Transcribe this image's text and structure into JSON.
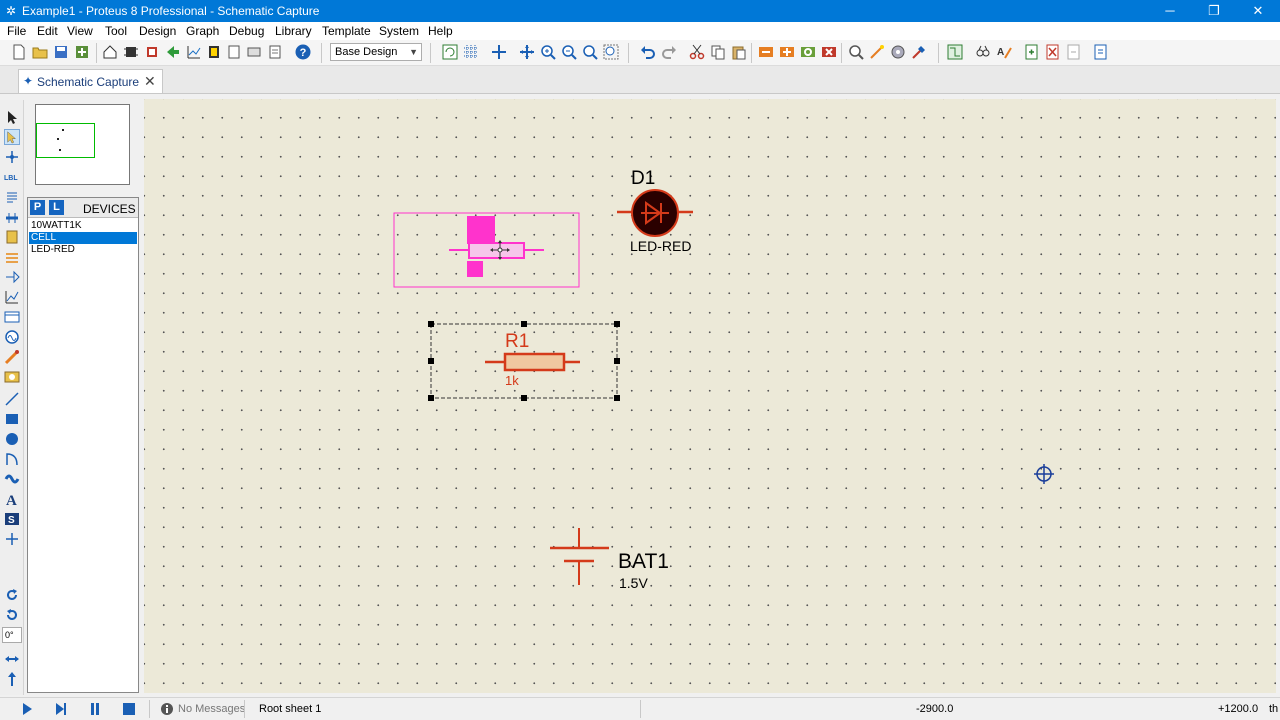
{
  "window": {
    "title": "Example1 - Proteus 8 Professional - Schematic Capture",
    "minimize": "─",
    "restore": "❐",
    "close": "✕"
  },
  "menu": [
    "File",
    "Edit",
    "View",
    "Tool",
    "Design",
    "Graph",
    "Debug",
    "Library",
    "Template",
    "System",
    "Help"
  ],
  "toolbar": {
    "design_select": "Base Design"
  },
  "tab": {
    "label": "Schematic Capture",
    "close": "✕"
  },
  "devices": {
    "p_button": "P",
    "l_button": "L",
    "title": "DEVICES",
    "items": [
      "10WATT1K",
      "CELL",
      "LED-RED"
    ],
    "selected": "CELL"
  },
  "schematic": {
    "d1_ref": "D1",
    "d1_value": "LED-RED",
    "r1_ref": "R1",
    "r1_value": "1k",
    "bat1_ref": "BAT1",
    "bat1_value": "1.5V"
  },
  "status": {
    "messages": "No Messages",
    "sheet": "Root sheet 1",
    "x_coord": "-2900.0",
    "y_coord": "+1200.0",
    "unit": "th",
    "rotation": "0°"
  },
  "colors": {
    "titlebar": "#0078d7",
    "canvas": "#ece9d8",
    "component_red": "#d43a1a",
    "ghost_magenta": "#ff33cc",
    "selection": "#0078d7"
  }
}
